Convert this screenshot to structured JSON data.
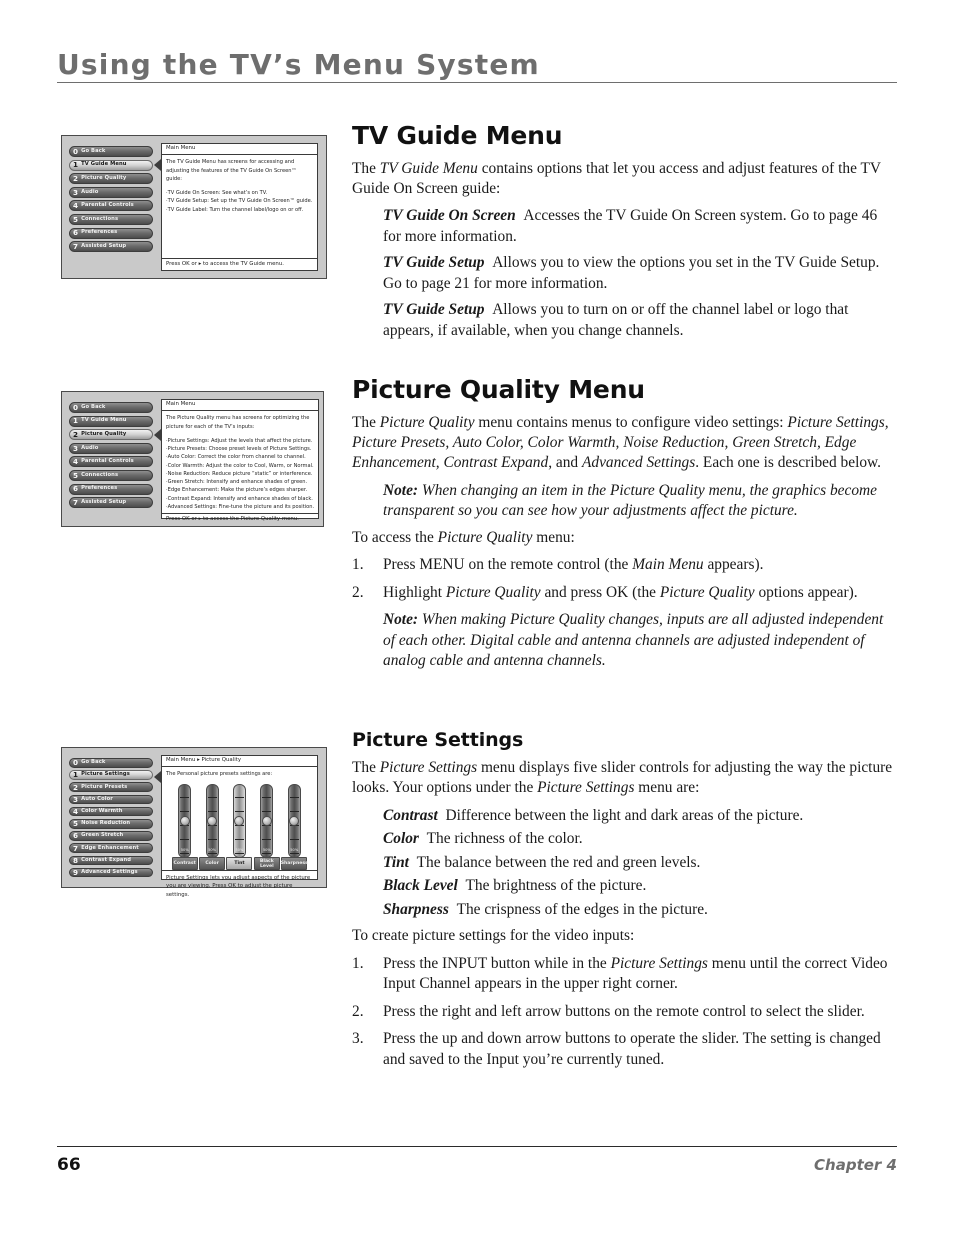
{
  "header": {
    "title": "Using the TV’s Menu System"
  },
  "footer": {
    "page_number": "66",
    "chapter": "Chapter 4"
  },
  "figures": [
    {
      "id": "tv-guide-menu-osd",
      "breadcrumb": "Main Menu",
      "lead": "The TV Guide Menu has screens for accessing and adjusting the features of the TV Guide On Screen™ guide:",
      "bullets": [
        "·TV Guide On Screen: See what’s on TV.",
        "·TV Guide Setup: Set up the TV Guide On Screen™ guide.",
        "·TV Guide Label: Turn the channel label/logo on or off."
      ],
      "footer": "Press OK or ▸ to access the TV Guide menu.",
      "selected_index": 1,
      "buttons": [
        {
          "num": "0",
          "label": "Go Back"
        },
        {
          "num": "1",
          "label": "TV Guide Menu"
        },
        {
          "num": "2",
          "label": "Picture Quality"
        },
        {
          "num": "3",
          "label": "Audio"
        },
        {
          "num": "4",
          "label": "Parental Controls"
        },
        {
          "num": "5",
          "label": "Connections"
        },
        {
          "num": "6",
          "label": "Preferences"
        },
        {
          "num": "7",
          "label": "Assisted Setup"
        }
      ]
    },
    {
      "id": "picture-quality-osd",
      "breadcrumb": "Main Menu",
      "lead": "The Picture Quality menu has screens for optimizing the picture for each of the TV’s inputs:",
      "bullets": [
        "·Picture Settings: Adjust the levels that affect the picture.",
        "·Picture Presets: Choose preset levels of Picture Settings.",
        "·Auto Color: Correct the color from channel to channel.",
        "·Color Warmth: Adjust the color to Cool, Warm, or Normal.",
        "·Noise Reduction: Reduce picture “static” or interference.",
        "·Green Stretch: Intensify and enhance shades of green.",
        "·Edge Enhancement: Make the picture’s edges sharper.",
        "·Contrast Expand: Intensify and enhance shades of black.",
        "·Advanced Settings: Fine-tune the picture and its position."
      ],
      "footer": "Press OK or ▸ to access the Picture Quality menu.",
      "selected_index": 2,
      "buttons": [
        {
          "num": "0",
          "label": "Go Back"
        },
        {
          "num": "1",
          "label": "TV Guide Menu"
        },
        {
          "num": "2",
          "label": "Picture Quality"
        },
        {
          "num": "3",
          "label": "Audio"
        },
        {
          "num": "4",
          "label": "Parental Controls"
        },
        {
          "num": "5",
          "label": "Connections"
        },
        {
          "num": "6",
          "label": "Preferences"
        },
        {
          "num": "7",
          "label": "Assisted Setup"
        }
      ]
    },
    {
      "id": "picture-settings-osd",
      "breadcrumb": "Main Menu ▸ Picture Quality",
      "lead": "The Personal picture presets settings are:",
      "footer": "Picture Settings lets you adjust aspects of the picture you are viewing. Press OK to adjust the picture settings.",
      "selected_index": 1,
      "buttons": [
        {
          "num": "0",
          "label": "Go Back"
        },
        {
          "num": "1",
          "label": "Picture Settings"
        },
        {
          "num": "2",
          "label": "Picture Presets"
        },
        {
          "num": "3",
          "label": "Auto Color"
        },
        {
          "num": "4",
          "label": "Color Warmth"
        },
        {
          "num": "5",
          "label": "Noise Reduction"
        },
        {
          "num": "6",
          "label": "Green Stretch"
        },
        {
          "num": "7",
          "label": "Edge Enhancement"
        },
        {
          "num": "8",
          "label": "Contrast Expand"
        },
        {
          "num": "9",
          "label": "Advanced Settings"
        }
      ],
      "sliders": [
        {
          "label": "Contrast",
          "value": "50%",
          "active": false
        },
        {
          "label": "Color",
          "value": "50%",
          "active": false
        },
        {
          "label": "Tint",
          "value": "50%",
          "active": true
        },
        {
          "label": "Black Level",
          "value": "50%",
          "active": false
        },
        {
          "label": "Sharpness",
          "value": "50%",
          "active": false
        }
      ]
    }
  ],
  "sections": {
    "tv_guide_menu": {
      "heading": "TV Guide Menu",
      "intro": "contains options that let you access and adjust features of the TV Guide On Screen guide:",
      "intro_lead": "The ",
      "intro_italic": "TV Guide Menu",
      "items": [
        {
          "term": "TV Guide On Screen",
          "desc": "Accesses the TV Guide On Screen system. Go to page 46 for more information."
        },
        {
          "term": "TV Guide Setup",
          "desc": "Allows you to view the options you set in the TV Guide Setup. Go to page 21 for more information."
        },
        {
          "term": "TV Guide Setup",
          "desc": "Allows you to turn on or off the channel label or logo that appears, if available, when you change channels."
        }
      ]
    },
    "picture_quality_menu": {
      "heading": "Picture Quality Menu",
      "intro_p1": "The ",
      "intro_i1": "Picture Quality",
      "intro_p2": " menu contains menus to configure video settings: ",
      "intro_i2": "Picture Settings, Picture Presets, Auto Color, Color Warmth, Noise Reduction, Green Stretch, Edge Enhancement, Contrast Expand",
      "intro_p3": ", and ",
      "intro_i3": "Advanced Settings",
      "intro_p4": ". Each one is described below.",
      "note1_label": "Note:",
      "note1_text": "When changing an item in the Picture Quality menu, the graphics become transparent so you can see how your adjustments affect the picture.",
      "access_lead_p1": "To access the ",
      "access_lead_i": "Picture Quality",
      "access_lead_p2": " menu:",
      "steps": [
        {
          "num": "1.",
          "p1": "Press MENU on the remote control (the ",
          "i1": "Main Menu",
          "p2": " appears)."
        },
        {
          "num": "2.",
          "p1": "Highlight ",
          "i1": "Picture Quality",
          "p2": " and press OK (the ",
          "i2": "Picture Quality",
          "p3": " options appear)."
        }
      ],
      "note2_label": "Note:",
      "note2_text": "When making Picture Quality changes, inputs are all adjusted independent of each other. Digital cable and antenna channels are adjusted independent of analog cable and antenna channels."
    },
    "picture_settings": {
      "heading": "Picture Settings",
      "intro_p1": "The ",
      "intro_i1": "Picture Settings",
      "intro_p2": " menu displays five slider controls for adjusting the way the picture looks. Your options under the ",
      "intro_i2": "Picture Settings",
      "intro_p3": " menu are:",
      "items": [
        {
          "term": "Contrast",
          "desc": "Difference between the light and dark areas of the picture."
        },
        {
          "term": "Color",
          "desc": "The richness of the color."
        },
        {
          "term": "Tint",
          "desc": "The balance between the red and green levels."
        },
        {
          "term": "Black Level",
          "desc": "The brightness of the picture."
        },
        {
          "term": "Sharpness",
          "desc": "The crispness of the edges in the picture."
        }
      ],
      "create_lead": "To create picture settings for the video inputs:",
      "steps": [
        {
          "num": "1.",
          "p1": "Press the INPUT button while in the ",
          "i1": "Picture Settings",
          "p2": " menu until the correct Video Input Channel appears in the upper right corner."
        },
        {
          "num": "2.",
          "p1": "Press the right and left arrow buttons on the remote control to select the slider.",
          "i1": "",
          "p2": ""
        },
        {
          "num": "3.",
          "p1": "Press the up and down arrow buttons to operate the slider. The setting is changed and saved to the Input you’re currently tuned.",
          "i1": "",
          "p2": ""
        }
      ]
    }
  },
  "colors": {
    "heading_gray": "#6e6e6e",
    "text_black": "#1a1a1a",
    "osd_bg": "#c9c9c9"
  }
}
